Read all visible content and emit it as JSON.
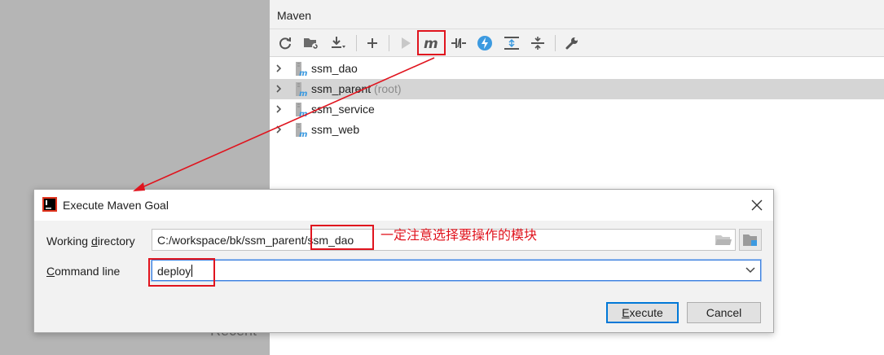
{
  "editor": {
    "recent_text": "Recent"
  },
  "maven": {
    "title": "Maven",
    "toolbar": [
      {
        "icon": "reload-icon"
      },
      {
        "icon": "generate-sources-icon"
      },
      {
        "icon": "download-icon"
      },
      {
        "icon": "add-icon"
      },
      {
        "icon": "run-icon"
      },
      {
        "icon": "execute-goal-icon"
      },
      {
        "icon": "toggle-offline-icon"
      },
      {
        "icon": "skip-tests-icon"
      },
      {
        "icon": "expand-all-icon"
      },
      {
        "icon": "collapse-all-icon"
      },
      {
        "icon": "settings-wrench-icon"
      }
    ],
    "tree": [
      {
        "label": "ssm_dao",
        "suffix": "",
        "selected": false
      },
      {
        "label": "ssm_parent",
        "suffix": "(root)",
        "selected": true
      },
      {
        "label": "ssm_service",
        "suffix": "",
        "selected": false
      },
      {
        "label": "ssm_web",
        "suffix": "",
        "selected": false
      }
    ]
  },
  "dialog": {
    "title": "Execute Maven Goal",
    "working_directory_label_pre": "Working ",
    "working_directory_label_mnemonic": "d",
    "working_directory_label_post": "irectory",
    "working_directory_value": "C:/workspace/bk/ssm_parent/ssm_dao",
    "command_line_label_mnemonic": "C",
    "command_line_label_post": "ommand line",
    "command_line_value": "deploy",
    "execute_mnemonic": "E",
    "execute_post": "xecute",
    "cancel_label": "Cancel"
  },
  "annotation": {
    "text": "一定注意选择要操作的模块",
    "color": "#e0141e"
  },
  "colors": {
    "accent_blue": "#3d80df",
    "selection_grey": "#d5d5d5",
    "annotation_red": "#e0141e"
  }
}
